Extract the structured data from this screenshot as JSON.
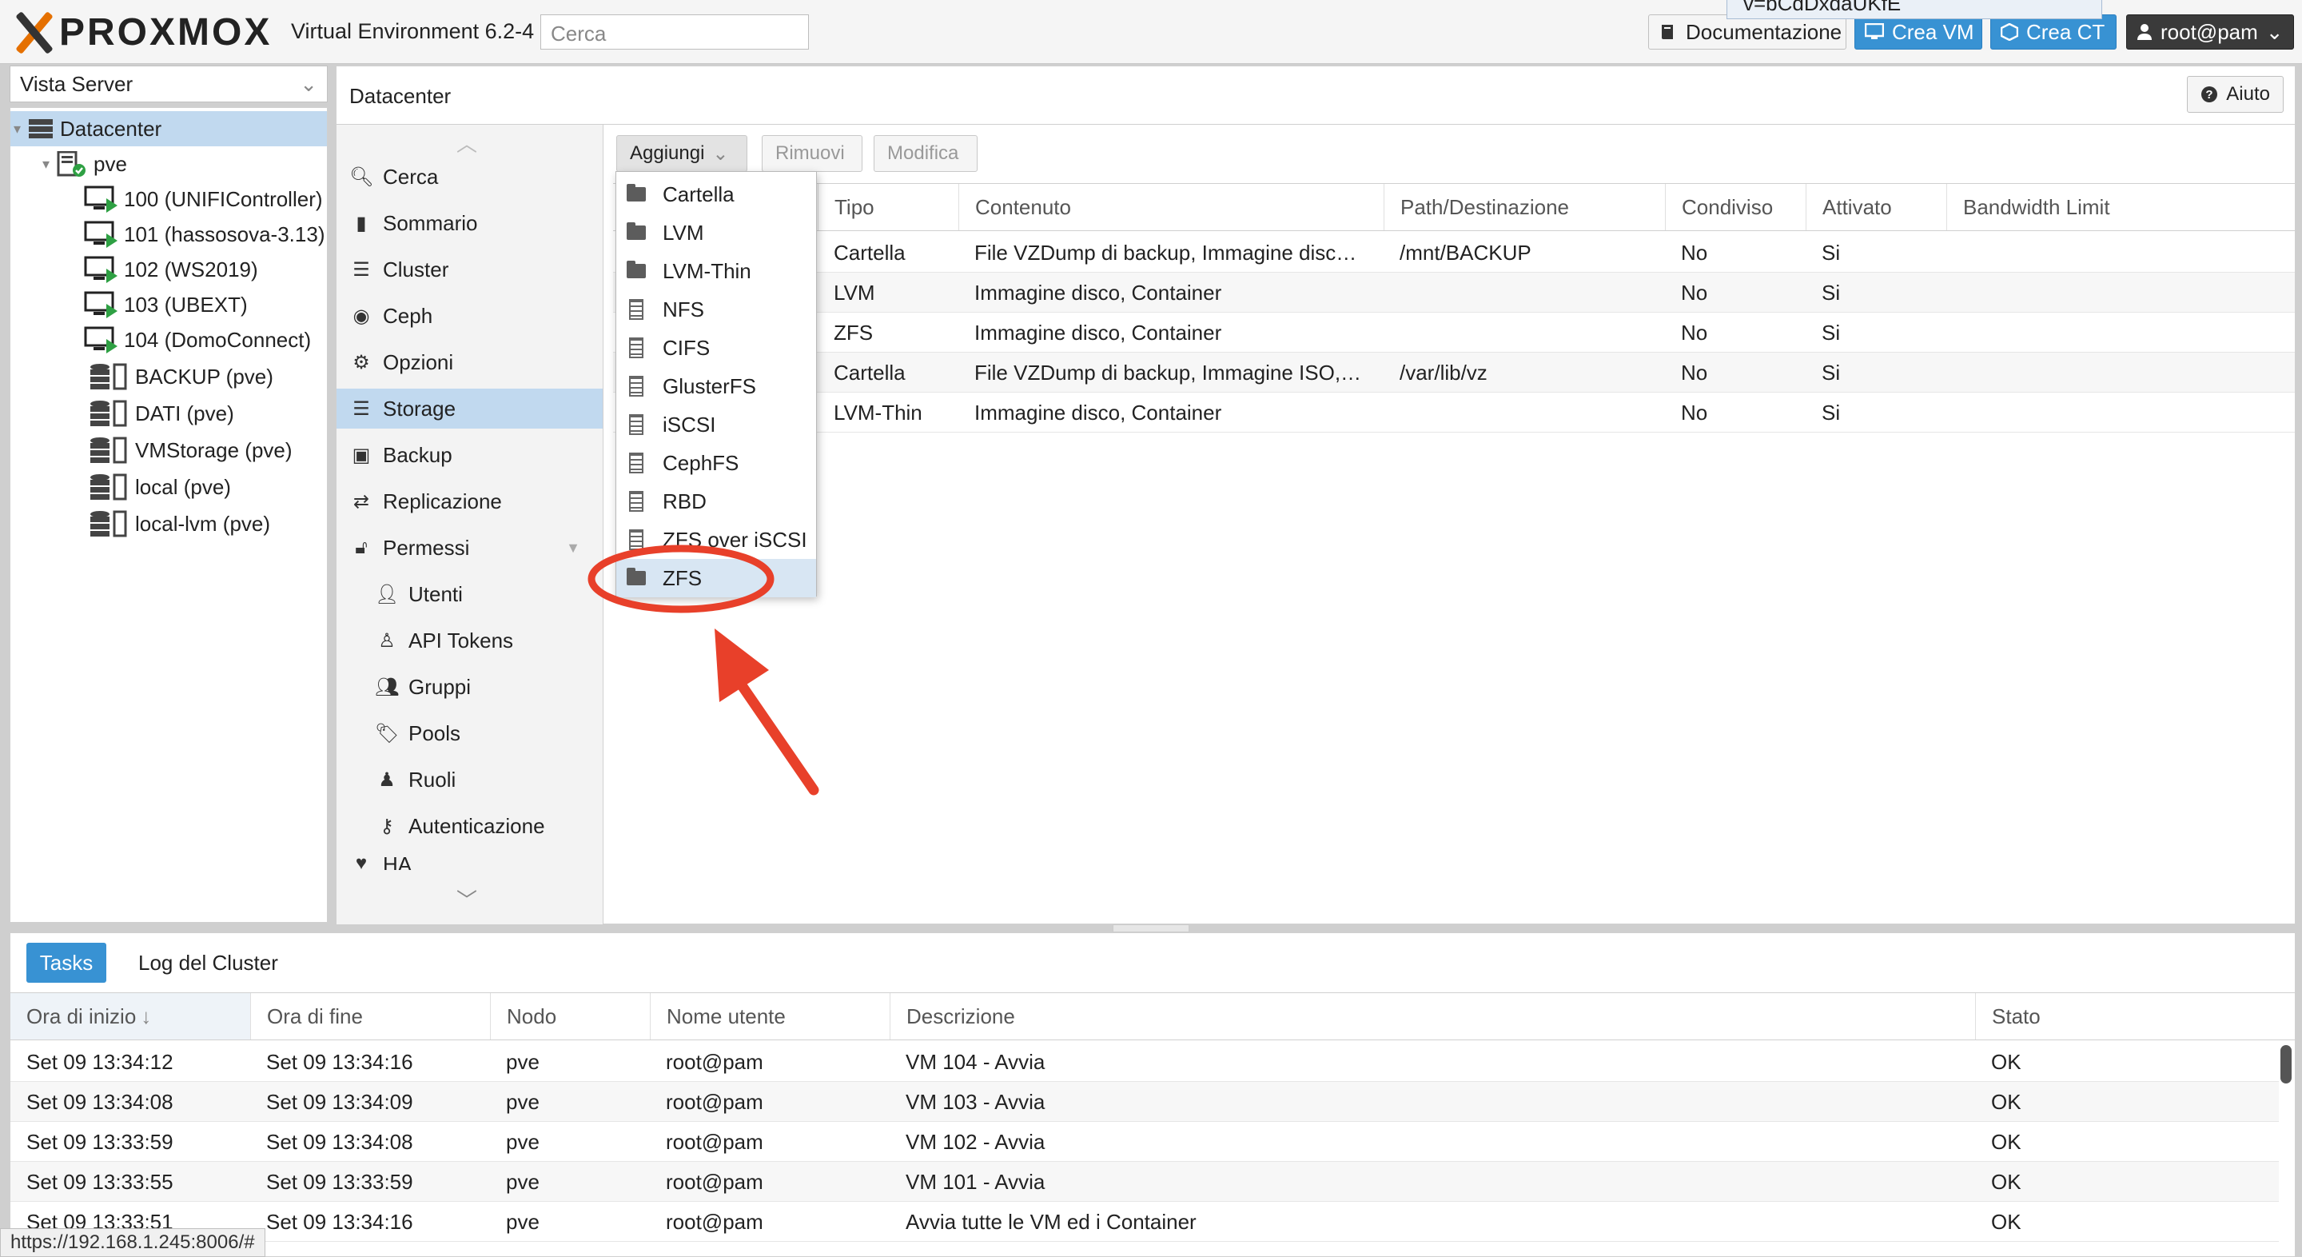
{
  "header": {
    "logo_text": "PROXMOX",
    "version": "Virtual Environment 6.2-4",
    "search_placeholder": "Cerca",
    "docs_button": "Documentazione",
    "create_vm_button": "Crea VM",
    "create_ct_button": "Crea CT",
    "user_button": "root@pam",
    "tooltip_text": "v=bCdDxdaUKfE"
  },
  "tree": {
    "view_select": "Vista Server",
    "datacenter": "Datacenter",
    "node": "pve",
    "vms": [
      "100 (UNIFIController)",
      "101 (hassosova-3.13)",
      "102 (WS2019)",
      "103 (UBEXT)",
      "104 (DomoConnect)"
    ],
    "storages": [
      "BACKUP (pve)",
      "DATI (pve)",
      "VMStorage (pve)",
      "local (pve)",
      "local-lvm (pve)"
    ]
  },
  "content": {
    "title": "Datacenter",
    "help_button": "Aiuto"
  },
  "nav": {
    "items": [
      {
        "label": "Cerca",
        "icon": "search-icon"
      },
      {
        "label": "Sommario",
        "icon": "book-icon"
      },
      {
        "label": "Cluster",
        "icon": "server-icon"
      },
      {
        "label": "Ceph",
        "icon": "ceph-icon"
      },
      {
        "label": "Opzioni",
        "icon": "gear-icon"
      },
      {
        "label": "Storage",
        "icon": "database-icon"
      },
      {
        "label": "Backup",
        "icon": "floppy-icon"
      },
      {
        "label": "Replicazione",
        "icon": "retweet-icon"
      },
      {
        "label": "Permessi",
        "icon": "unlock-icon"
      },
      {
        "label": "Utenti",
        "icon": "user-icon"
      },
      {
        "label": "API Tokens",
        "icon": "user-outline-icon"
      },
      {
        "label": "Gruppi",
        "icon": "users-icon"
      },
      {
        "label": "Pools",
        "icon": "tags-icon"
      },
      {
        "label": "Ruoli",
        "icon": "male-icon"
      },
      {
        "label": "Autenticazione",
        "icon": "key-icon"
      },
      {
        "label": "HA",
        "icon": "heartbeat-icon"
      }
    ]
  },
  "toolbar": {
    "add": "Aggiungi",
    "remove": "Rimuovi",
    "edit": "Modifica"
  },
  "storage_grid": {
    "columns": [
      "Tipo",
      "Contenuto",
      "Path/Destinazione",
      "Condiviso",
      "Attivato",
      "Bandwidth Limit"
    ],
    "rows": [
      [
        "Cartella",
        "File VZDump di backup, Immagine disc…",
        "/mnt/BACKUP",
        "No",
        "Si",
        ""
      ],
      [
        "LVM",
        "Immagine disco, Container",
        "",
        "No",
        "Si",
        ""
      ],
      [
        "ZFS",
        "Immagine disco, Container",
        "",
        "No",
        "Si",
        ""
      ],
      [
        "Cartella",
        "File VZDump di backup, Immagine ISO,…",
        "/var/lib/vz",
        "No",
        "Si",
        ""
      ],
      [
        "LVM-Thin",
        "Immagine disco, Container",
        "",
        "No",
        "Si",
        ""
      ]
    ]
  },
  "add_menu": {
    "items": [
      {
        "label": "Cartella",
        "icon": "folder-icon"
      },
      {
        "label": "LVM",
        "icon": "folder-icon"
      },
      {
        "label": "LVM-Thin",
        "icon": "folder-icon"
      },
      {
        "label": "NFS",
        "icon": "building-icon"
      },
      {
        "label": "CIFS",
        "icon": "building-icon"
      },
      {
        "label": "GlusterFS",
        "icon": "building-icon"
      },
      {
        "label": "iSCSI",
        "icon": "building-icon"
      },
      {
        "label": "CephFS",
        "icon": "building-icon"
      },
      {
        "label": "RBD",
        "icon": "building-icon"
      },
      {
        "label": "ZFS over iSCSI",
        "icon": "building-icon"
      },
      {
        "label": "ZFS",
        "icon": "folder-icon"
      }
    ],
    "highlighted": "ZFS"
  },
  "bottom": {
    "tabs": [
      "Tasks",
      "Log del Cluster"
    ],
    "columns": [
      "Ora di inizio",
      "Ora di fine",
      "Nodo",
      "Nome utente",
      "Descrizione",
      "Stato"
    ],
    "sort_arrow": "↓",
    "rows": [
      [
        "Set 09 13:34:12",
        "Set 09 13:34:16",
        "pve",
        "root@pam",
        "VM 104 - Avvia",
        "OK"
      ],
      [
        "Set 09 13:34:08",
        "Set 09 13:34:09",
        "pve",
        "root@pam",
        "VM 103 - Avvia",
        "OK"
      ],
      [
        "Set 09 13:33:59",
        "Set 09 13:34:08",
        "pve",
        "root@pam",
        "VM 102 - Avvia",
        "OK"
      ],
      [
        "Set 09 13:33:55",
        "Set 09 13:33:59",
        "pve",
        "root@pam",
        "VM 101 - Avvia",
        "OK"
      ],
      [
        "Set 09 13:33:51",
        "Set 09 13:34:16",
        "pve",
        "root@pam",
        "Avvia tutte le VM ed i Container",
        "OK"
      ]
    ]
  },
  "status_url": "https://192.168.1.245:8006/#",
  "colors": {
    "accent": "#3892d3",
    "selection": "#c1d9ef",
    "brand_orange": "#e57000",
    "annotation_red": "#e8402a"
  }
}
